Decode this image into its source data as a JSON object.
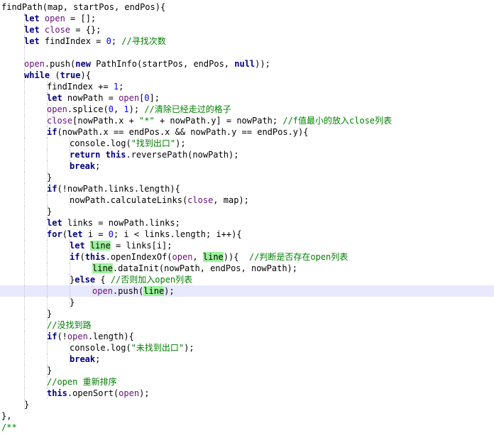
{
  "code_lines": [
    {
      "indent": 1,
      "tokens": [
        {
          "t": "findPath(map, startPos, endPos){",
          "c": "p"
        }
      ]
    },
    {
      "indent": 2,
      "tokens": [
        {
          "t": "let ",
          "c": "kw"
        },
        {
          "t": "open",
          "c": "id"
        },
        {
          "t": " = [];",
          "c": "p"
        }
      ]
    },
    {
      "indent": 2,
      "tokens": [
        {
          "t": "let ",
          "c": "kw"
        },
        {
          "t": "close",
          "c": "id"
        },
        {
          "t": " = {};",
          "c": "p"
        }
      ]
    },
    {
      "indent": 2,
      "tokens": [
        {
          "t": "let ",
          "c": "kw"
        },
        {
          "t": "findIndex = ",
          "c": "p"
        },
        {
          "t": "0",
          "c": "num"
        },
        {
          "t": "; ",
          "c": "p"
        },
        {
          "t": "//寻找次数",
          "c": "cmt"
        }
      ]
    },
    {
      "indent": 2,
      "tokens": []
    },
    {
      "indent": 2,
      "tokens": [
        {
          "t": "open",
          "c": "id"
        },
        {
          "t": ".push(",
          "c": "p"
        },
        {
          "t": "new ",
          "c": "kw"
        },
        {
          "t": "PathInfo(startPos, endPos, ",
          "c": "p"
        },
        {
          "t": "null",
          "c": "kw"
        },
        {
          "t": "));",
          "c": "p"
        }
      ]
    },
    {
      "indent": 2,
      "tokens": [
        {
          "t": "while ",
          "c": "kw"
        },
        {
          "t": "(",
          "c": "p"
        },
        {
          "t": "true",
          "c": "kw"
        },
        {
          "t": "){",
          "c": "p"
        }
      ]
    },
    {
      "indent": 3,
      "tokens": [
        {
          "t": "findIndex += ",
          "c": "p"
        },
        {
          "t": "1",
          "c": "num"
        },
        {
          "t": ";",
          "c": "p"
        }
      ]
    },
    {
      "indent": 3,
      "tokens": [
        {
          "t": "let ",
          "c": "kw"
        },
        {
          "t": "nowPath = ",
          "c": "p"
        },
        {
          "t": "open",
          "c": "id"
        },
        {
          "t": "[",
          "c": "p"
        },
        {
          "t": "0",
          "c": "num"
        },
        {
          "t": "];",
          "c": "p"
        }
      ]
    },
    {
      "indent": 3,
      "tokens": [
        {
          "t": "open",
          "c": "id"
        },
        {
          "t": ".splice(",
          "c": "p"
        },
        {
          "t": "0",
          "c": "num"
        },
        {
          "t": ", ",
          "c": "p"
        },
        {
          "t": "1",
          "c": "num"
        },
        {
          "t": "); ",
          "c": "p"
        },
        {
          "t": "//清除已经走过的格子",
          "c": "cmt"
        }
      ]
    },
    {
      "indent": 3,
      "tokens": [
        {
          "t": "close",
          "c": "id"
        },
        {
          "t": "[nowPath.x + ",
          "c": "p"
        },
        {
          "t": "\"*\"",
          "c": "str"
        },
        {
          "t": " + nowPath.y] = nowPath; ",
          "c": "p"
        },
        {
          "t": "//f值最小的放入close列表",
          "c": "cmt"
        }
      ]
    },
    {
      "indent": 3,
      "tokens": [
        {
          "t": "if",
          "c": "kw"
        },
        {
          "t": "(nowPath.x == endPos.x && nowPath.y == endPos.y){",
          "c": "p"
        }
      ]
    },
    {
      "indent": 4,
      "tokens": [
        {
          "t": "console.log(",
          "c": "p"
        },
        {
          "t": "\"找到出口\"",
          "c": "str"
        },
        {
          "t": ");",
          "c": "p"
        }
      ]
    },
    {
      "indent": 4,
      "tokens": [
        {
          "t": "return this",
          "c": "kw"
        },
        {
          "t": ".reversePath(nowPath);",
          "c": "p"
        }
      ]
    },
    {
      "indent": 4,
      "tokens": [
        {
          "t": "break",
          "c": "kw"
        },
        {
          "t": ";",
          "c": "p"
        }
      ]
    },
    {
      "indent": 3,
      "tokens": [
        {
          "t": "}",
          "c": "p"
        }
      ]
    },
    {
      "indent": 3,
      "tokens": [
        {
          "t": "if",
          "c": "kw"
        },
        {
          "t": "(!nowPath.links.length){",
          "c": "p"
        }
      ]
    },
    {
      "indent": 4,
      "tokens": [
        {
          "t": "nowPath.calculateLinks(",
          "c": "p"
        },
        {
          "t": "close",
          "c": "id"
        },
        {
          "t": ", map);",
          "c": "p"
        }
      ]
    },
    {
      "indent": 3,
      "tokens": [
        {
          "t": "}",
          "c": "p"
        }
      ]
    },
    {
      "indent": 3,
      "tokens": [
        {
          "t": "let ",
          "c": "kw"
        },
        {
          "t": "links = nowPath.links;",
          "c": "p"
        }
      ]
    },
    {
      "indent": 3,
      "tokens": [
        {
          "t": "for",
          "c": "kw"
        },
        {
          "t": "(",
          "c": "p"
        },
        {
          "t": "let ",
          "c": "kw"
        },
        {
          "t": "i = ",
          "c": "p"
        },
        {
          "t": "0",
          "c": "num"
        },
        {
          "t": "; i < links.length; i++){",
          "c": "p"
        }
      ]
    },
    {
      "indent": 4,
      "tokens": [
        {
          "t": "let ",
          "c": "kw"
        },
        {
          "t": "line",
          "c": "hl"
        },
        {
          "t": " = links[i];",
          "c": "p"
        }
      ]
    },
    {
      "indent": 4,
      "tokens": [
        {
          "t": "if",
          "c": "kw"
        },
        {
          "t": "(",
          "c": "p"
        },
        {
          "t": "this",
          "c": "kw"
        },
        {
          "t": ".openIndexOf(",
          "c": "p"
        },
        {
          "t": "open",
          "c": "id"
        },
        {
          "t": ", ",
          "c": "p"
        },
        {
          "t": "line",
          "c": "hl"
        },
        {
          "t": ")){  ",
          "c": "p"
        },
        {
          "t": "//判断是否存在open列表",
          "c": "cmt"
        }
      ]
    },
    {
      "indent": 5,
      "tokens": [
        {
          "t": "line",
          "c": "hl"
        },
        {
          "t": ".dataInit(nowPath, endPos, nowPath);",
          "c": "p"
        }
      ]
    },
    {
      "indent": 4,
      "tokens": [
        {
          "t": "}",
          "c": "p"
        },
        {
          "t": "else ",
          "c": "kw"
        },
        {
          "t": "{ ",
          "c": "p"
        },
        {
          "t": "//否则加入open列表",
          "c": "cmt"
        }
      ]
    },
    {
      "indent": 5,
      "current": true,
      "tokens": [
        {
          "t": "open",
          "c": "id"
        },
        {
          "t": ".push(",
          "c": "p"
        },
        {
          "t": "line",
          "c": "hl"
        },
        {
          "t": ");",
          "c": "p"
        }
      ]
    },
    {
      "indent": 4,
      "tokens": [
        {
          "t": "}",
          "c": "p"
        }
      ]
    },
    {
      "indent": 3,
      "tokens": [
        {
          "t": "}",
          "c": "p"
        }
      ]
    },
    {
      "indent": 3,
      "tokens": [
        {
          "t": "//没找到路",
          "c": "cmt"
        }
      ]
    },
    {
      "indent": 3,
      "tokens": [
        {
          "t": "if",
          "c": "kw"
        },
        {
          "t": "(!",
          "c": "p"
        },
        {
          "t": "open",
          "c": "id"
        },
        {
          "t": ".length){",
          "c": "p"
        }
      ]
    },
    {
      "indent": 4,
      "tokens": [
        {
          "t": "console.log(",
          "c": "p"
        },
        {
          "t": "\"未找到出口\"",
          "c": "str"
        },
        {
          "t": ");",
          "c": "p"
        }
      ]
    },
    {
      "indent": 4,
      "tokens": [
        {
          "t": "break",
          "c": "kw"
        },
        {
          "t": ";",
          "c": "p"
        }
      ]
    },
    {
      "indent": 3,
      "tokens": [
        {
          "t": "}",
          "c": "p"
        }
      ]
    },
    {
      "indent": 3,
      "tokens": [
        {
          "t": "//open 重新排序",
          "c": "cmt"
        }
      ]
    },
    {
      "indent": 3,
      "tokens": [
        {
          "t": "this",
          "c": "kw"
        },
        {
          "t": ".openSort(",
          "c": "p"
        },
        {
          "t": "open",
          "c": "id"
        },
        {
          "t": ");",
          "c": "p"
        }
      ]
    },
    {
      "indent": 2,
      "tokens": [
        {
          "t": "}",
          "c": "p"
        }
      ]
    },
    {
      "indent": 1,
      "tokens": [
        {
          "t": "},",
          "c": "p"
        }
      ]
    },
    {
      "indent": 1,
      "tokens": [
        {
          "t": "/**",
          "c": "cmt"
        }
      ]
    }
  ]
}
